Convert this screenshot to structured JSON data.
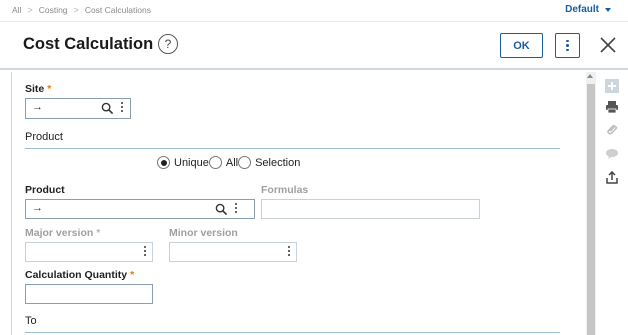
{
  "breadcrumb": [
    "All",
    "Costing",
    "Cost Calculations"
  ],
  "profile_menu": "Default",
  "header": {
    "title": "Cost Calculation",
    "help_glyph": "?",
    "ok_label": "OK"
  },
  "form": {
    "site": {
      "label": "Site",
      "value": "",
      "arrow": "→"
    },
    "product_section": "Product",
    "radios": {
      "selected": "Unique",
      "options": [
        "Unique",
        "All",
        "Selection"
      ]
    },
    "product": {
      "label": "Product",
      "value": "",
      "arrow": "→"
    },
    "formulas": {
      "label": "Formulas",
      "value": ""
    },
    "major_version": {
      "label": "Major version",
      "value": ""
    },
    "minor_version": {
      "label": "Minor version",
      "value": ""
    },
    "calc_quantity": {
      "label": "Calculation Quantity",
      "value": ""
    },
    "to_section": "To",
    "required_mark": "*"
  },
  "tools": [
    "plus-icon",
    "print-icon",
    "attachment-icon",
    "comment-icon",
    "export-icon"
  ],
  "colors": {
    "accent": "#1a5e9c",
    "required": "#e07b1a"
  }
}
